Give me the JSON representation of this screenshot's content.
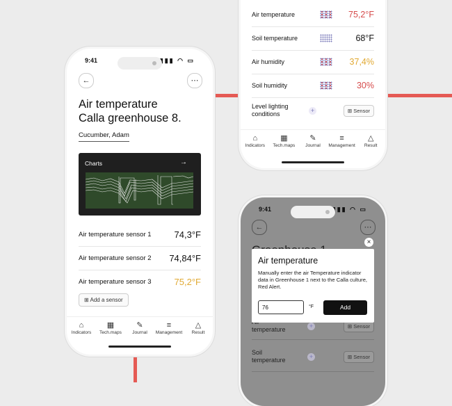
{
  "status": {
    "time": "9:41",
    "icons": "▮▮▮ ◠ ▭"
  },
  "nav_tabs": [
    {
      "label": "Indicators",
      "icon": "⌂"
    },
    {
      "label": "Tech.maps",
      "icon": "▦"
    },
    {
      "label": "Journal",
      "icon": "✎"
    },
    {
      "label": "Management",
      "icon": "≡"
    },
    {
      "label": "Result",
      "icon": "△"
    }
  ],
  "main": {
    "back_icon": "←",
    "more_icon": "⋯",
    "title_line1": "Air temperature",
    "title_line2": "Calla greenhouse 8.",
    "subtitle": "Cucumber, Adam",
    "charts_label": "Charts",
    "charts_arrow": "→",
    "sensors": [
      {
        "name": "Air temperature sensor 1",
        "value": "74,3°F",
        "color": "#111111"
      },
      {
        "name": "Air temperature sensor 2",
        "value": "74,84°F",
        "color": "#111111"
      },
      {
        "name": "Air temperature sensor 3",
        "value": "75,2°F",
        "color": "#e1a932"
      }
    ],
    "add_sensor": "Add a sensor",
    "add_icon": "⊞"
  },
  "right_top": {
    "rows": [
      {
        "name": "Air temperature",
        "value": "75,2°F",
        "color": "#d64b4b",
        "pattern": "red"
      },
      {
        "name": "Soil temperature",
        "value": "68°F",
        "color": "#111111",
        "pattern": "plain"
      },
      {
        "name": "Air humidity",
        "value": "37,4%",
        "color": "#e1a932",
        "pattern": "red"
      },
      {
        "name": "Soil humidity",
        "value": "30%",
        "color": "#d64b4b",
        "pattern": "red"
      }
    ],
    "lighting_line1": "Level lighting",
    "lighting_line2": "conditions",
    "sensor_btn": "Sensor",
    "plus": "+"
  },
  "right_bottom": {
    "back_icon": "←",
    "more_icon": "⋯",
    "heading": "Greenhouse 1",
    "dialog": {
      "close": "×",
      "title": "Air temperature",
      "body": "Manually enter the air Temperature indicator data in Greenhouse 1 next to the Calla culture, Red Alert.",
      "input_value": "76",
      "unit": "°F",
      "button": "Add"
    },
    "rows": [
      {
        "line1": "Air",
        "line2": "temperature"
      },
      {
        "line1": "Soil",
        "line2": "temperature"
      }
    ],
    "sensor_btn": "Sensor",
    "plus": "+"
  },
  "colors": {
    "accent_red": "#e55a54",
    "warn_yellow": "#e1a932",
    "alert_red": "#d64b4b",
    "chart_green": "#2f4a2a"
  }
}
